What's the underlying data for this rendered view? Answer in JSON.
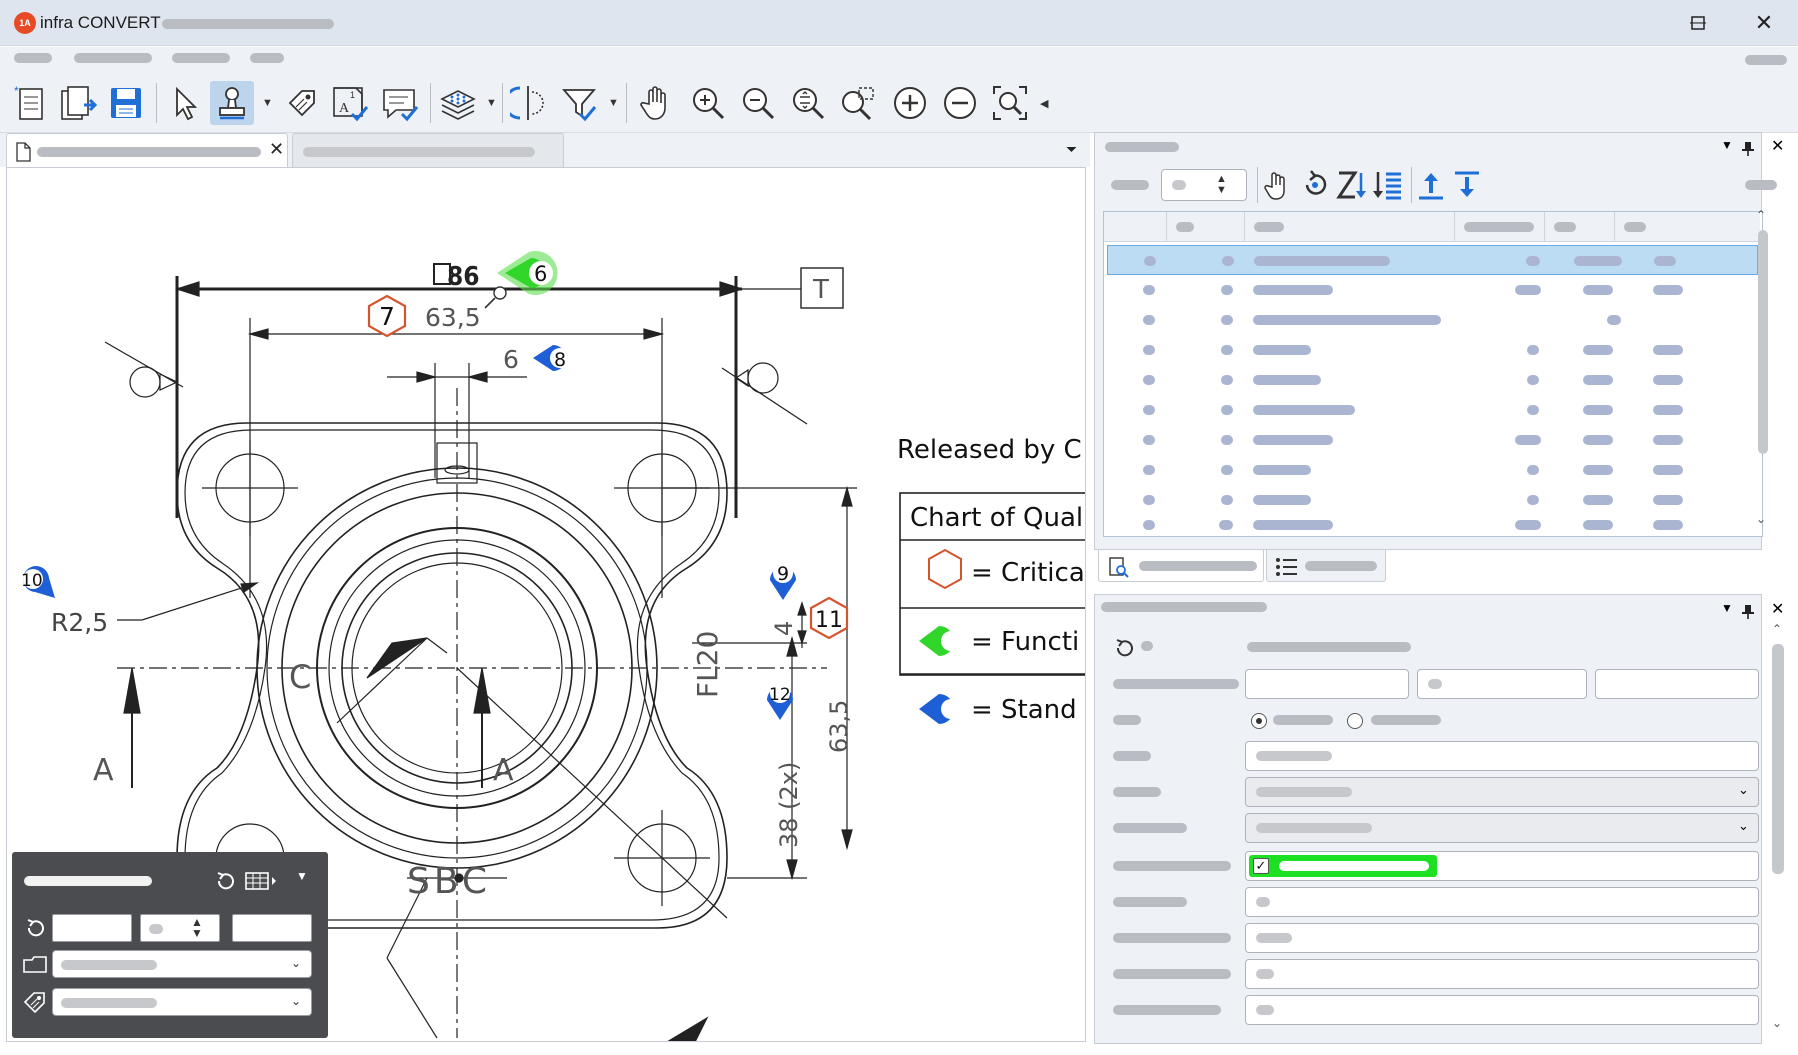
{
  "app": {
    "title": "infra CONVERT",
    "logo_text": "1A",
    "brand_color": "#e74b25"
  },
  "window_controls": {
    "minimize": "—",
    "maximize": "☐",
    "close": "✕"
  },
  "toolbar": {
    "icons": [
      "new-document-icon",
      "export-document-icon",
      "save-icon",
      "select-pointer-icon",
      "stamp-icon",
      "tag-icon",
      "text-check-icon",
      "comment-check-icon",
      "layers-icon",
      "measure-icon",
      "filter-icon",
      "pan-hand-icon",
      "zoom-in-icon",
      "zoom-out-icon",
      "zoom-fit-icon",
      "zoom-area-icon",
      "zoom-plus-icon",
      "zoom-minus-icon",
      "zoom-extents-icon"
    ]
  },
  "drawing": {
    "dim_top": "86",
    "dim_63_5": "63,5",
    "dim_6": "6",
    "datum_T": "T",
    "radius_label": "R2,5",
    "section_A1": "A",
    "section_A2": "A",
    "label_C": "C",
    "label_FL20": "FL20",
    "dim_4": "4",
    "dim_63_5_v": "63,5",
    "dim_38": "38 (2x)",
    "label_SBC": "SBC",
    "released_text": "Released by C",
    "balloons": {
      "b6": "6",
      "b7": "7",
      "b8": "8",
      "b9": "9",
      "b10": "10",
      "b11": "11",
      "b12": "12"
    },
    "legend": {
      "header": "Chart of Qual",
      "critical": "= Critica",
      "functional": "= Functi",
      "standard": "= Stand"
    },
    "colors": {
      "critical": "#d4552c",
      "functional": "#32d62a",
      "standard": "#1f5fd6"
    }
  }
}
